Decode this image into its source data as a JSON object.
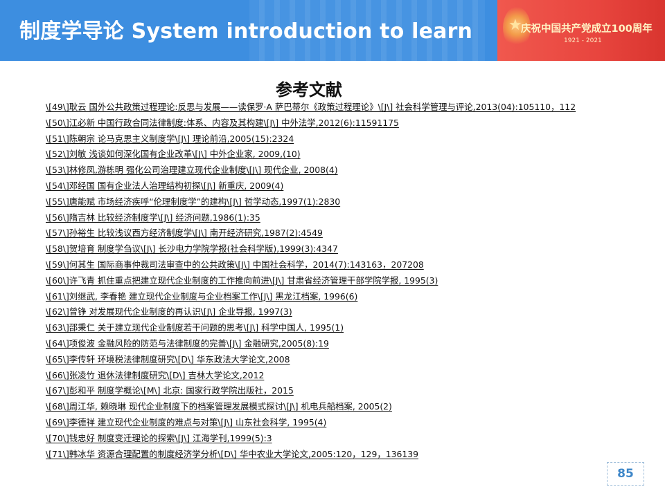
{
  "header": {
    "title": "制度学导论 System introduction to learn",
    "banner_text": "庆祝中国共产党成立100周年",
    "banner_years": "1921 - 2021"
  },
  "page_title": "参考文献",
  "references": [
    "\\[49\\]耿云    国外公共政策过程理论:反思与发展——读保罗·A   萨巴蒂尔《政策过程理论》\\[J\\]    社会科学管理与评论,2013(04):105110，112   ",
    "\\[50\\]江必新    中国行政合同法律制度:体系、内容及其构建\\[J\\]    中外法学,2012(6):11591175   ",
    "\\[51\\]陈朝宗    论马克思主义制度学\\[J\\]    理论前沿,2005(15):2324   ",
    "\\[52\\]刘敏    浅谈如何深化国有企业改革\\[J\\]    中外企业家, 2009,(10)   ",
    "\\[53\\]林修凤,游栋明    强化公司治理建立现代企业制度\\[J\\]    现代企业, 2008(4)   ",
    "\\[54\\]邓经国    国有企业法人治理结构初探\\[J\\]    新重庆, 2009(4)   ",
    "\\[55\\]唐能赋    市场经济疾呼“伦理制度学”的建构\\[J\\]    哲学动态,1997(1):2830   ",
    "\\[56\\]隋吉林    比较经济制度学\\[J\\]    经济问题,1986(1):35   ",
    "\\[57\\]孙裕生    比较浅议西方经济制度学\\[J\\]    南开经济研究,1987(2):4549   ",
    "\\[58\\]贺培育    制度学刍议\\[J\\]    长沙电力学院学报(社会科学版),1999(3):4347   ",
    "\\[59\\]何其生    国际商事仲裁司法审查中的公共政策\\[J\\]    中国社会科学，2014(7):143163，207208   ",
    "\\[60\\]许飞青    抓住重点把建立现代企业制度的工作推向前进\\[J\\]    甘肃省经济管理干部学院学报, 1995(3)   ",
    "\\[61\\]刘继武, 李春艳    建立现代企业制度与企业档案工作\\[J\\]    黑龙江档案, 1996(6)",
    "\\[62\\]曾铮    对发展现代企业制度的再认识\\[J\\]    企业导报, 1997(3)   ",
    "\\[63\\]邵秉仁    关于建立现代企业制度若干问题的思考\\[J\\]    科学中国人, 1995(1)   ",
    "\\[64\\]项俊波    金融风险的防范与法律制度的完善\\[J\\]    金融研究,2005(8):19   ",
    "\\[65\\]李传轩    环境税法律制度研究\\[D\\]    华东政法大学论文,2008   ",
    "\\[66\\]张凌竹    退休法律制度研究\\[D\\]    吉林大学论文,2012   ",
    "\\[67\\]彭和平    制度学概论\\[M\\]    北京: 国家行政学院出版社，2015   ",
    "\\[68\\]周江华, 赖晓琳    现代企业制度下的档案管理发展模式探讨\\[J\\]    机电兵船档案, 2005(2)   ",
    "\\[69\\]李德祥    建立现代企业制度的难点与对策\\[J\\]    山东社会科学, 1995(4)   ",
    "\\[70\\]钱忠好    制度变迁理论的探索\\[J\\]    江海学刊,1999(5):3   ",
    "\\[71\\]韩冰华    资源合理配置的制度经济学分析\\[D\\]    华中农业大学论文,2005:120，129，136139"
  ],
  "page_number": "85",
  "colors": {
    "header_blue": "#3d8ee0",
    "banner_red": "#e8453e",
    "page_number_blue": "#3d86c8"
  }
}
